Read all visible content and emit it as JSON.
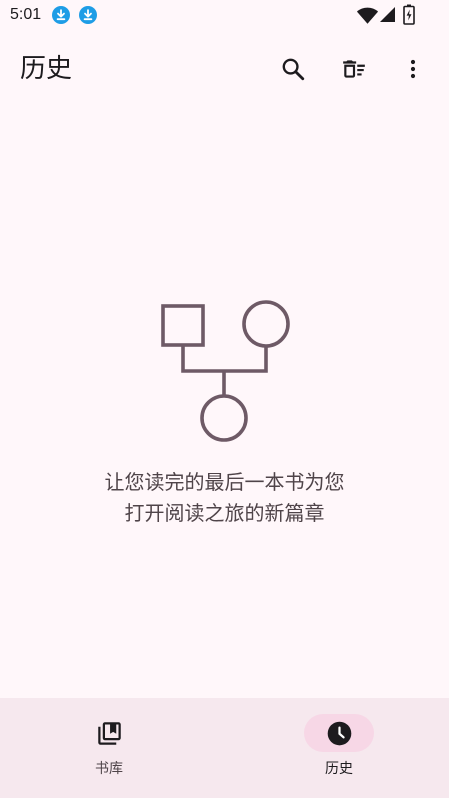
{
  "status_bar": {
    "time": "5:01",
    "notification_icons": [
      "download-icon",
      "download-icon"
    ],
    "system_icons": [
      "wifi-icon",
      "cell-signal-icon",
      "battery-charging-icon"
    ]
  },
  "app_bar": {
    "title": "历史",
    "actions": [
      "search-icon",
      "delete-sweep-icon",
      "more-vert-icon"
    ]
  },
  "empty_state": {
    "message_lines": [
      "让您读完的最后一本书为您",
      "打开阅读之旅的新篇章"
    ]
  },
  "bottom_nav": {
    "items": [
      {
        "label": "书库",
        "icon": "collections-bookmark-icon",
        "selected": false
      },
      {
        "label": "历史",
        "icon": "history-clock-icon",
        "selected": true
      }
    ]
  },
  "colors": {
    "background": "#FFF7FA",
    "nav_background": "#F6E8EE",
    "nav_indicator": "#F7D7E6",
    "illustration_stroke": "#6E5A66",
    "text_primary": "#1D1B1E",
    "text_secondary": "#4F4449",
    "notification_blue": "#1E9DE6"
  }
}
